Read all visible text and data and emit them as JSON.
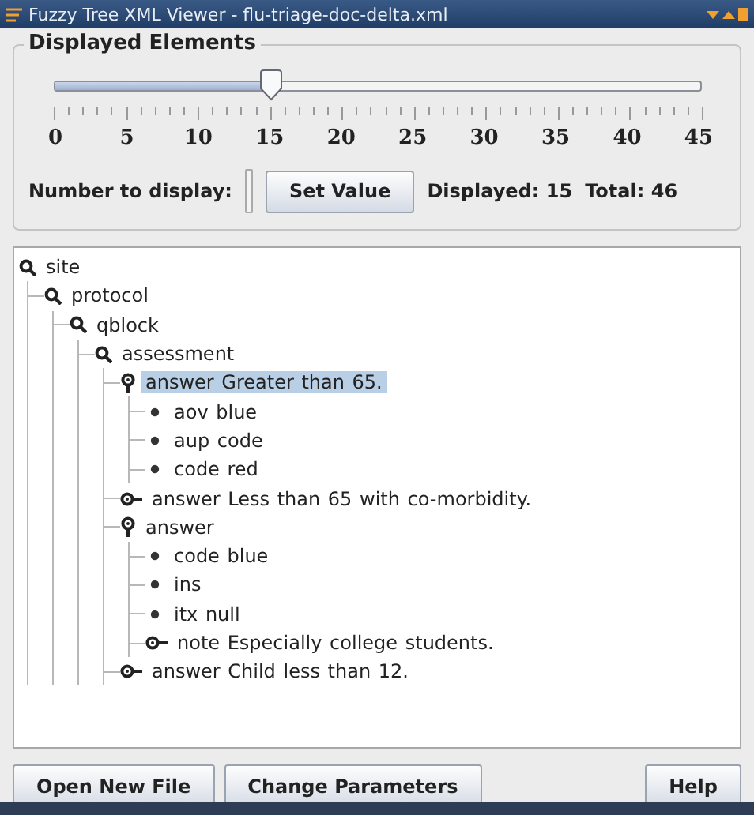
{
  "window": {
    "title": "Fuzzy Tree XML Viewer - flu-triage-doc-delta.xml"
  },
  "elements_panel": {
    "title": "Displayed Elements",
    "slider": {
      "level": 0.333,
      "labels": [
        "0",
        "5",
        "10",
        "15",
        "20",
        "25",
        "30",
        "35",
        "40",
        "45"
      ]
    },
    "number_label": "Number to display:",
    "set_button": "Set Value",
    "displayed": "Displayed: 15",
    "total": "Total: 46"
  },
  "tree": [
    {
      "kind": "group",
      "name": "site",
      "selected": false,
      "children": [
        {
          "kind": "group",
          "name": "protocol",
          "selected": false,
          "children": [
            {
              "kind": "group",
              "name": "qblock",
              "selected": false,
              "children": [
                {
                  "kind": "group",
                  "name": "assessment",
                  "selected": false,
                  "children": [
                    {
                      "kind": "item",
                      "name": "answer",
                      "value": "Greater than 65.",
                      "expanded": true,
                      "selected": true,
                      "children": [
                        {
                          "kind": "leaf",
                          "name": "aov",
                          "value": "blue",
                          "selected": false
                        },
                        {
                          "kind": "leaf",
                          "name": "aup",
                          "value": "code",
                          "selected": false
                        },
                        {
                          "kind": "leaf",
                          "name": "code",
                          "value": "red",
                          "selected": false
                        }
                      ]
                    },
                    {
                      "kind": "item",
                      "name": "answer",
                      "value": "Less than 65 with co-morbidity.",
                      "expanded": false,
                      "selected": false
                    },
                    {
                      "kind": "item",
                      "name": "answer",
                      "expanded": true,
                      "selected": false,
                      "children": [
                        {
                          "kind": "leaf",
                          "name": "code",
                          "value": "blue",
                          "selected": false
                        },
                        {
                          "kind": "leaf",
                          "name": "ins",
                          "selected": false
                        },
                        {
                          "kind": "leaf",
                          "name": "itx",
                          "value": "null",
                          "selected": false
                        },
                        {
                          "kind": "item",
                          "name": "note",
                          "value": "Especially college students.",
                          "expanded": false,
                          "selected": false
                        }
                      ]
                    },
                    {
                      "kind": "item",
                      "name": "answer",
                      "value": "Child less than 12.",
                      "expanded": false,
                      "selected": false
                    }
                  ]
                }
              ]
            }
          ]
        }
      ]
    }
  ],
  "buttons": [
    "Open New File",
    "Change Parameters",
    "Help"
  ]
}
